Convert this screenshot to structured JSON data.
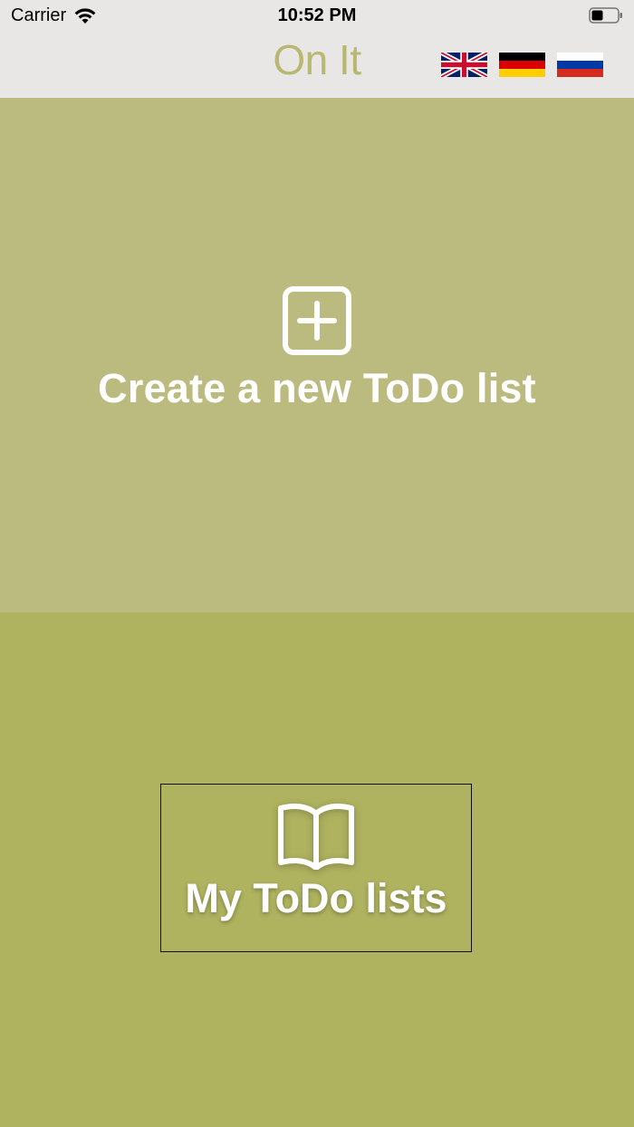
{
  "status_bar": {
    "carrier": "Carrier",
    "time": "10:52 PM"
  },
  "nav": {
    "title": "On It",
    "title_color": "#b9b873",
    "languages": [
      {
        "code": "en",
        "icon": "uk-flag-icon"
      },
      {
        "code": "de",
        "icon": "germany-flag-icon"
      },
      {
        "code": "ru",
        "icon": "russia-flag-icon"
      }
    ]
  },
  "create_panel": {
    "label": "Create a new ToDo list",
    "icon": "plus-square-icon",
    "background": "#bbba7f"
  },
  "lists_panel": {
    "label": "My ToDo lists",
    "icon": "book-icon",
    "background": "#afb35f"
  }
}
